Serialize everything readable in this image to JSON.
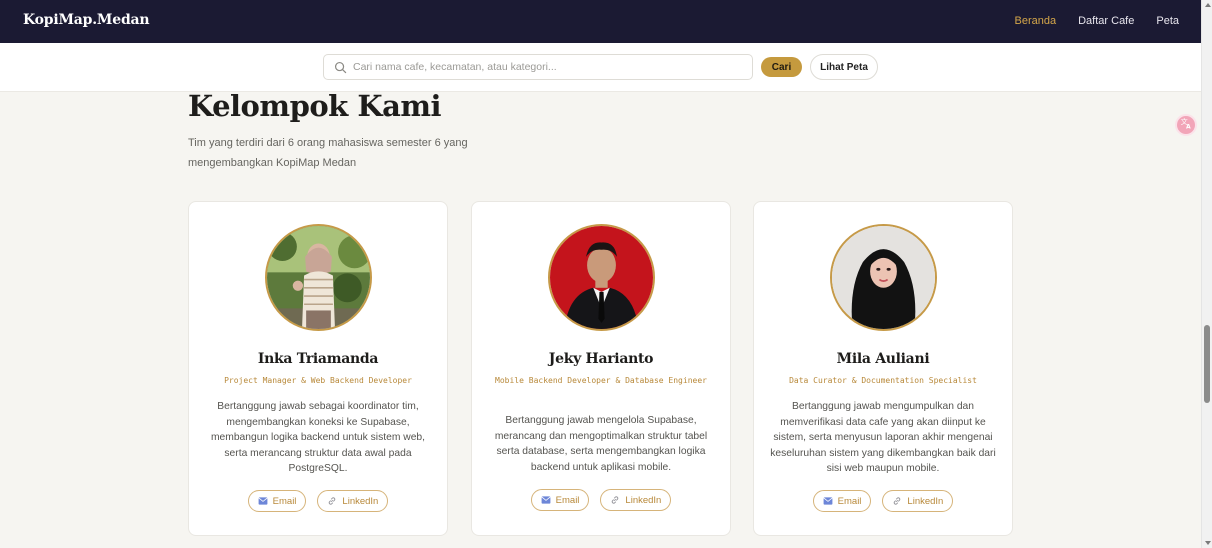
{
  "navbar": {
    "brand": "KopiMap.Medan",
    "links": [
      {
        "label": "Beranda",
        "active": true
      },
      {
        "label": "Daftar Cafe",
        "active": false
      },
      {
        "label": "Peta",
        "active": false
      }
    ]
  },
  "search": {
    "placeholder": "Cari nama cafe, kecamatan, atau kategori...",
    "value": "",
    "submit_label": "Cari",
    "map_label": "Lihat Peta"
  },
  "section": {
    "title": "Kelompok Kami",
    "subtitle": "Tim yang terdiri dari 6 orang mahasiswa semester 6 yang mengembangkan KopiMap Medan"
  },
  "members": [
    {
      "name": "Inka Triamanda",
      "role": "Project Manager & Web Backend Developer",
      "description": "Bertanggung jawab sebagai koordinator tim, mengembangkan koneksi ke Supabase, membangun logika backend untuk sistem web, serta merancang struktur data awal pada PostgreSQL.",
      "email_label": "Email",
      "linkedin_label": "LinkedIn"
    },
    {
      "name": "Jeky Harianto",
      "role": "Mobile Backend Developer & Database Engineer",
      "description": "Bertanggung jawab mengelola Supabase, merancang dan mengoptimalkan struktur tabel serta database, serta mengembangkan logika backend untuk aplikasi mobile.",
      "email_label": "Email",
      "linkedin_label": "LinkedIn"
    },
    {
      "name": "Mila Auliani",
      "role": "Data Curator & Documentation Specialist",
      "description": "Bertanggung jawab mengumpulkan dan memverifikasi data cafe yang akan diinput ke sistem, serta menyusun laporan akhir mengenai keseluruhan sistem yang dikembangkan baik dari sisi web maupun mobile.",
      "email_label": "Email",
      "linkedin_label": "LinkedIn"
    }
  ],
  "colors": {
    "navbar_bg": "#1b1a33",
    "accent": "#c59a3e",
    "active_link": "#d4a64a",
    "page_bg": "#f6f5f1"
  },
  "icons": {
    "search": "search-icon",
    "email": "email-icon",
    "linkedin": "link-icon",
    "translate": "translate-icon"
  }
}
